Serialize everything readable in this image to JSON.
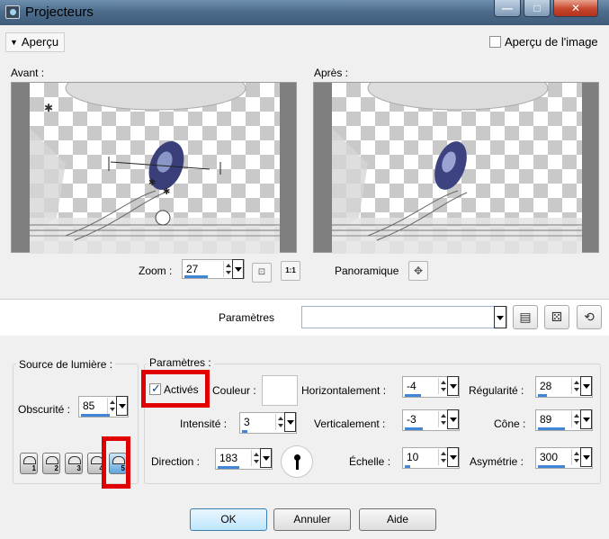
{
  "window": {
    "title": "Projecteurs"
  },
  "apercu": {
    "toggle_label": "Aperçu",
    "image_checkbox_label": "Aperçu de l'image",
    "image_checked": false
  },
  "preview": {
    "before_label": "Avant :",
    "after_label": "Après :"
  },
  "zoom": {
    "label": "Zoom :",
    "value": "27",
    "fit_icon": "fit-icon",
    "actual_size_label": "1:1"
  },
  "pan": {
    "label": "Panoramique"
  },
  "presets_bar": {
    "label": "Paramètres",
    "value": "",
    "save_icon": "save-icon",
    "random_icon": "dice-icon",
    "reset_icon": "reset-icon"
  },
  "light_source": {
    "title": "Source de lumière :",
    "darkness_label": "Obscurité :",
    "darkness_value": "85",
    "presets": [
      "1",
      "2",
      "3",
      "4",
      "5"
    ],
    "active_preset": "5"
  },
  "params": {
    "title": "Paramètres :",
    "enabled_label": "Activés",
    "enabled": true,
    "color_label": "Couleur :",
    "color_value": "#ffffff",
    "intensity_label": "Intensité :",
    "intensity_value": "3",
    "direction_label": "Direction :",
    "direction_value": "183",
    "horizontal_label": "Horizontalement :",
    "horizontal_value": "-4",
    "vertical_label": "Verticalement :",
    "vertical_value": "-3",
    "scale_label": "Échelle :",
    "scale_value": "10",
    "regularity_label": "Régularité :",
    "regularity_value": "28",
    "cone_label": "Cône :",
    "cone_value": "89",
    "asymmetry_label": "Asymétrie :",
    "asymmetry_value": "300"
  },
  "buttons": {
    "ok": "OK",
    "cancel": "Annuler",
    "help": "Aide"
  },
  "accent_color": "#3f86d6",
  "highlight_color": "#e00000"
}
